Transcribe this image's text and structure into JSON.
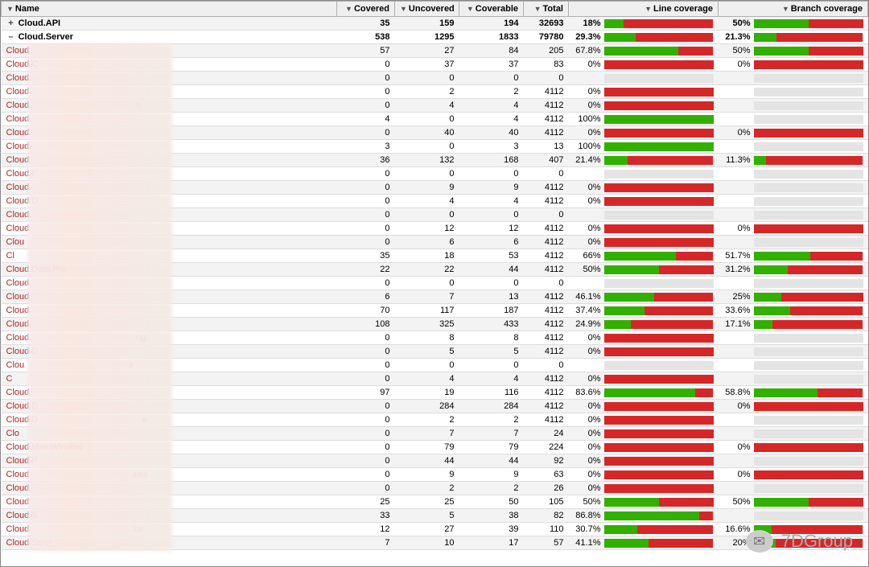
{
  "headers": {
    "name": "Name",
    "covered": "Covered",
    "uncovered": "Uncovered",
    "coverable": "Coverable",
    "total": "Total",
    "line": "Line coverage",
    "branch": "Branch coverage"
  },
  "summary": [
    {
      "expand": "+",
      "name": "Cloud.API",
      "covered": 35,
      "uncovered": 159,
      "coverable": 194,
      "total": 32693,
      "linePct": "18%",
      "lineVal": 18,
      "branchPct": "50%",
      "branchVal": 50
    },
    {
      "expand": "–",
      "name": "Cloud.Server",
      "covered": 538,
      "uncovered": 1295,
      "coverable": 1833,
      "total": 79780,
      "linePct": "29.3%",
      "lineVal": 29.3,
      "branchPct": "21.3%",
      "branchVal": 21.3
    }
  ],
  "rows": [
    {
      "name": "Cloud",
      "covered": 57,
      "uncovered": 27,
      "coverable": 84,
      "total": 205,
      "linePct": "67.8%",
      "lineVal": 67.8,
      "branchPct": "50%",
      "branchVal": 50
    },
    {
      "name": "Cloud.C",
      "covered": 0,
      "uncovered": 37,
      "coverable": 37,
      "total": 83,
      "linePct": "0%",
      "lineVal": 0,
      "branchPct": "0%",
      "branchVal": 0
    },
    {
      "name": "Cloud.",
      "covered": 0,
      "uncovered": 0,
      "coverable": 0,
      "total": 0,
      "linePct": null,
      "lineVal": null,
      "branchPct": null,
      "branchVal": null
    },
    {
      "name": "Cloud.",
      "covered": 0,
      "uncovered": 2,
      "coverable": 2,
      "total": 4112,
      "linePct": "0%",
      "lineVal": 0,
      "branchPct": null,
      "branchVal": null
    },
    {
      "name": "Cloud.",
      "suffix": "e",
      "covered": 0,
      "uncovered": 4,
      "coverable": 4,
      "total": 4112,
      "linePct": "0%",
      "lineVal": 0,
      "branchPct": null,
      "branchVal": null
    },
    {
      "name": "Cloud.",
      "covered": 4,
      "uncovered": 0,
      "coverable": 4,
      "total": 4112,
      "linePct": "100%",
      "lineVal": 100,
      "branchPct": null,
      "branchVal": null
    },
    {
      "name": "Cloud.",
      "covered": 0,
      "uncovered": 40,
      "coverable": 40,
      "total": 4112,
      "linePct": "0%",
      "lineVal": 0,
      "branchPct": "0%",
      "branchVal": 0
    },
    {
      "name": "Cloud.",
      "covered": 3,
      "uncovered": 0,
      "coverable": 3,
      "total": 13,
      "linePct": "100%",
      "lineVal": 100,
      "branchPct": null,
      "branchVal": null
    },
    {
      "name": "Cloud.",
      "covered": 36,
      "uncovered": 132,
      "coverable": 168,
      "total": 407,
      "linePct": "21.4%",
      "lineVal": 21.4,
      "branchPct": "11.3%",
      "branchVal": 11.3
    },
    {
      "name": "Cloud.I",
      "covered": 0,
      "uncovered": 0,
      "coverable": 0,
      "total": 0,
      "linePct": null,
      "lineVal": null,
      "branchPct": null,
      "branchVal": null
    },
    {
      "name": "Cloud.",
      "covered": 0,
      "uncovered": 9,
      "coverable": 9,
      "total": 4112,
      "linePct": "0%",
      "lineVal": 0,
      "branchPct": null,
      "branchVal": null
    },
    {
      "name": "Cloud.D",
      "covered": 0,
      "uncovered": 4,
      "coverable": 4,
      "total": 4112,
      "linePct": "0%",
      "lineVal": 0,
      "branchPct": null,
      "branchVal": null
    },
    {
      "name": "Cloud.",
      "covered": 0,
      "uncovered": 0,
      "coverable": 0,
      "total": 0,
      "linePct": null,
      "lineVal": null,
      "branchPct": null,
      "branchVal": null
    },
    {
      "name": "Cloud.",
      "covered": 0,
      "uncovered": 12,
      "coverable": 12,
      "total": 4112,
      "linePct": "0%",
      "lineVal": 0,
      "branchPct": "0%",
      "branchVal": 0
    },
    {
      "name": "Clou",
      "covered": 0,
      "uncovered": 6,
      "coverable": 6,
      "total": 4112,
      "linePct": "0%",
      "lineVal": 0,
      "branchPct": null,
      "branchVal": null
    },
    {
      "name": "Cl",
      "covered": 35,
      "uncovered": 18,
      "coverable": 53,
      "total": 4112,
      "linePct": "66%",
      "lineVal": 66,
      "branchPct": "51.7%",
      "branchVal": 51.7
    },
    {
      "name": "Cloud.Data.Pre",
      "covered": 22,
      "uncovered": 22,
      "coverable": 44,
      "total": 4112,
      "linePct": "50%",
      "lineVal": 50,
      "branchPct": "31.2%",
      "branchVal": 31.2
    },
    {
      "name": "Cloud.",
      "covered": 0,
      "uncovered": 0,
      "coverable": 0,
      "total": 0,
      "linePct": null,
      "lineVal": null,
      "branchPct": null,
      "branchVal": null
    },
    {
      "name": "Cloud.",
      "covered": 6,
      "uncovered": 7,
      "coverable": 13,
      "total": 4112,
      "linePct": "46.1%",
      "lineVal": 46.1,
      "branchPct": "25%",
      "branchVal": 25
    },
    {
      "name": "Cloud.",
      "covered": 70,
      "uncovered": 117,
      "coverable": 187,
      "total": 4112,
      "linePct": "37.4%",
      "lineVal": 37.4,
      "branchPct": "33.6%",
      "branchVal": 33.6
    },
    {
      "name": "Cloud.",
      "covered": 108,
      "uncovered": 325,
      "coverable": 433,
      "total": 4112,
      "linePct": "24.9%",
      "lineVal": 24.9,
      "branchPct": "17.1%",
      "branchVal": 17.1
    },
    {
      "name": "Cloud.",
      "suffix": "ng",
      "covered": 0,
      "uncovered": 8,
      "coverable": 8,
      "total": 4112,
      "linePct": "0%",
      "lineVal": 0,
      "branchPct": null,
      "branchVal": null
    },
    {
      "name": "Cloud.D",
      "covered": 0,
      "uncovered": 5,
      "coverable": 5,
      "total": 4112,
      "linePct": "0%",
      "lineVal": 0,
      "branchPct": null,
      "branchVal": null
    },
    {
      "name": "Clou",
      "suffix": "e",
      "covered": 0,
      "uncovered": 0,
      "coverable": 0,
      "total": 0,
      "linePct": null,
      "lineVal": null,
      "branchPct": null,
      "branchVal": null
    },
    {
      "name": "C",
      "covered": 0,
      "uncovered": 4,
      "coverable": 4,
      "total": 4112,
      "linePct": "0%",
      "lineVal": 0,
      "branchPct": null,
      "branchVal": null
    },
    {
      "name": "Cloud.",
      "covered": 97,
      "uncovered": 19,
      "coverable": 116,
      "total": 4112,
      "linePct": "83.6%",
      "lineVal": 83.6,
      "branchPct": "58.8%",
      "branchVal": 58.8
    },
    {
      "name": "Cloud.D",
      "covered": 0,
      "uncovered": 284,
      "coverable": 284,
      "total": 4112,
      "linePct": "0%",
      "lineVal": 0,
      "branchPct": "0%",
      "branchVal": 0
    },
    {
      "name": "Cloud.D",
      "suffix": "e",
      "covered": 0,
      "uncovered": 2,
      "coverable": 2,
      "total": 4112,
      "linePct": "0%",
      "lineVal": 0,
      "branchPct": null,
      "branchVal": null
    },
    {
      "name": "Clo",
      "covered": 0,
      "uncovered": 7,
      "coverable": 7,
      "total": 24,
      "linePct": "0%",
      "lineVal": 0,
      "branchPct": null,
      "branchVal": null
    },
    {
      "name": "Cloud.MainWindow",
      "covered": 0,
      "uncovered": 79,
      "coverable": 79,
      "total": 224,
      "linePct": "0%",
      "lineVal": 0,
      "branchPct": "0%",
      "branchVal": 0
    },
    {
      "name": "Cloud.P",
      "covered": 0,
      "uncovered": 44,
      "coverable": 44,
      "total": 92,
      "linePct": "0%",
      "lineVal": 0,
      "branchPct": null,
      "branchVal": null
    },
    {
      "name": "Cloud",
      "suffix": "ces",
      "covered": 0,
      "uncovered": 9,
      "coverable": 9,
      "total": 63,
      "linePct": "0%",
      "lineVal": 0,
      "branchPct": "0%",
      "branchVal": 0
    },
    {
      "name": "Cloud.",
      "covered": 0,
      "uncovered": 2,
      "coverable": 2,
      "total": 26,
      "linePct": "0%",
      "lineVal": 0,
      "branchPct": null,
      "branchVal": null
    },
    {
      "name": "Cloud",
      "covered": 25,
      "uncovered": 25,
      "coverable": 50,
      "total": 105,
      "linePct": "50%",
      "lineVal": 50,
      "branchPct": "50%",
      "branchVal": 50
    },
    {
      "name": "Cloud.S",
      "covered": 33,
      "uncovered": 5,
      "coverable": 38,
      "total": 82,
      "linePct": "86.8%",
      "lineVal": 86.8,
      "branchPct": null,
      "branchVal": null
    },
    {
      "name": "Cloud",
      "suffix": "ce",
      "covered": 12,
      "uncovered": 27,
      "coverable": 39,
      "total": 110,
      "linePct": "30.7%",
      "lineVal": 30.7,
      "branchPct": "16.6%",
      "branchVal": 16.6
    },
    {
      "name": "Cloud.Servi",
      "covered": 7,
      "uncovered": 10,
      "coverable": 17,
      "total": 57,
      "linePct": "41.1%",
      "lineVal": 41.1,
      "branchPct": "20%",
      "branchVal": 20
    }
  ],
  "watermark": "7DGroup"
}
